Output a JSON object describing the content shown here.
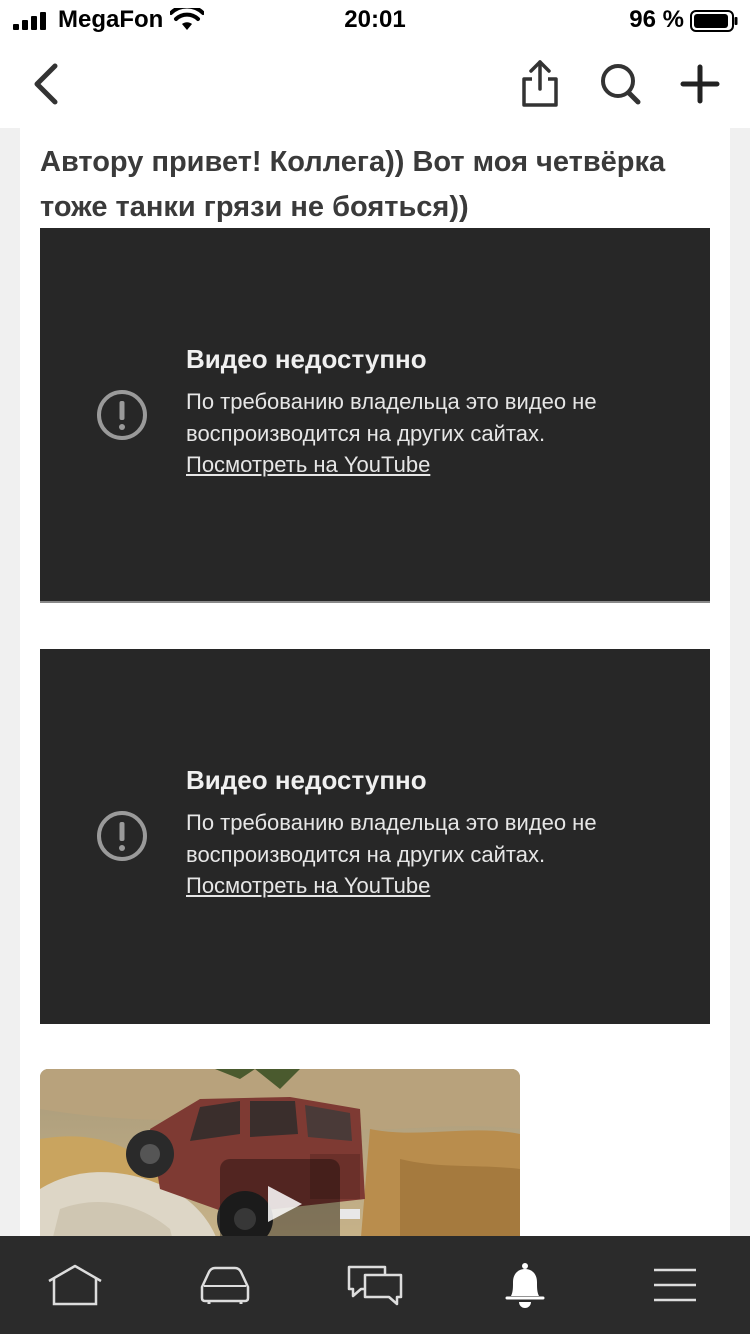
{
  "status_bar": {
    "carrier": "MegaFon",
    "time": "20:01",
    "battery_percent": "96 %"
  },
  "nav": {
    "icons": [
      "back-icon",
      "share-icon",
      "search-icon",
      "plus-icon"
    ]
  },
  "comment": {
    "text": "Автору привет! Коллега)) Вот моя четвёрка тоже танки грязи не бояться))"
  },
  "videos": [
    {
      "title": "Видео недоступно",
      "message": "По требованию владельца это видео не воспроизводится на других сайтах.",
      "link": "Посмотреть на YouTube"
    },
    {
      "title": "Видео недоступно",
      "message": "По требованию владельца это видео не воспроизводится на других сайтах.",
      "link": "Посмотреть на YouTube"
    }
  ],
  "photo": {
    "has_play_button": true
  },
  "tabbar": {
    "icons": [
      "home-icon",
      "car-icon",
      "chat-icon",
      "bell-icon",
      "menu-icon"
    ],
    "active": "bell-icon"
  },
  "colors": {
    "video_bg": "#272727",
    "tabbar_bg": "#2b2b2b",
    "text_dark": "#3a3a3a"
  }
}
